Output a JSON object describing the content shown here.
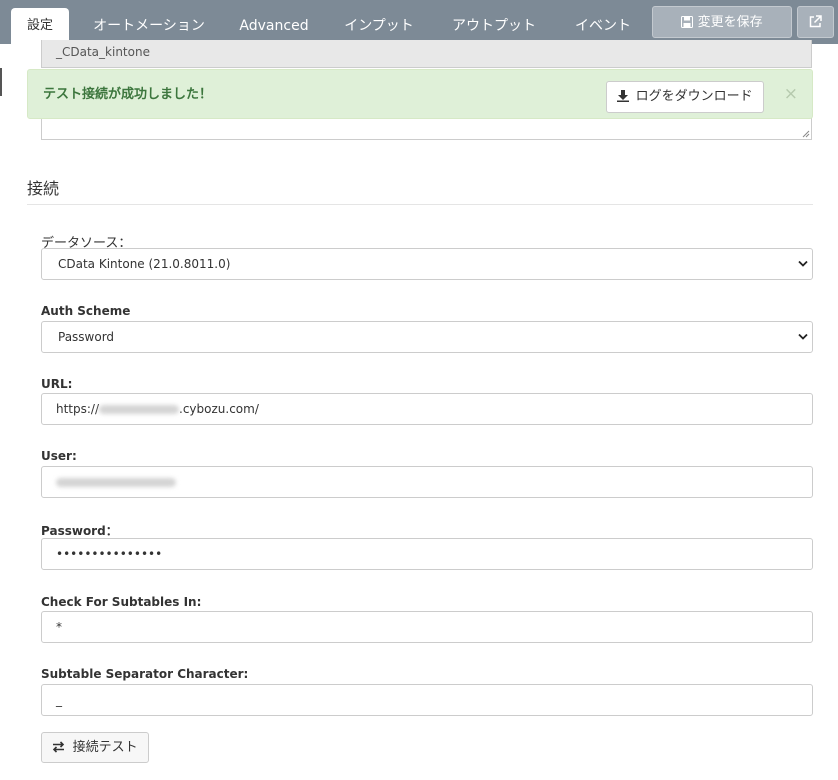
{
  "tabs": [
    {
      "label": "設定"
    },
    {
      "label": "オートメーション"
    },
    {
      "label": "Advanced"
    },
    {
      "label": "インプット"
    },
    {
      "label": "アウトプット"
    },
    {
      "label": "イベント"
    }
  ],
  "toolbar": {
    "save_label": "変更を保存",
    "save_icon": "save-icon",
    "external_icon": "external-link-icon"
  },
  "top_field": {
    "value": "_CData_kintone"
  },
  "alert": {
    "message": "テスト接続が成功しました！",
    "download_label": "ログをダウンロード",
    "download_icon": "download-icon",
    "close": "×",
    "color": "#3c763d",
    "background": "#dff0d8"
  },
  "section": {
    "title": "接続"
  },
  "form": {
    "datasource_label": "データソース：",
    "datasource_value": "CData Kintone (21.0.8011.0)",
    "auth_label": "Auth Scheme",
    "auth_value": "Password",
    "url_label": "URL:",
    "url_prefix": "https://",
    "url_suffix": ".cybozu.com/",
    "user_label": "User:",
    "password_label": "Password：",
    "password_value": "•••••••••••••••",
    "subtables_label": "Check For Subtables In:",
    "subtables_value": "*",
    "separator_label": "Subtable Separator Character:",
    "separator_value": "_"
  },
  "test_button": {
    "label": "接続テスト",
    "icon": "exchange-icon"
  }
}
